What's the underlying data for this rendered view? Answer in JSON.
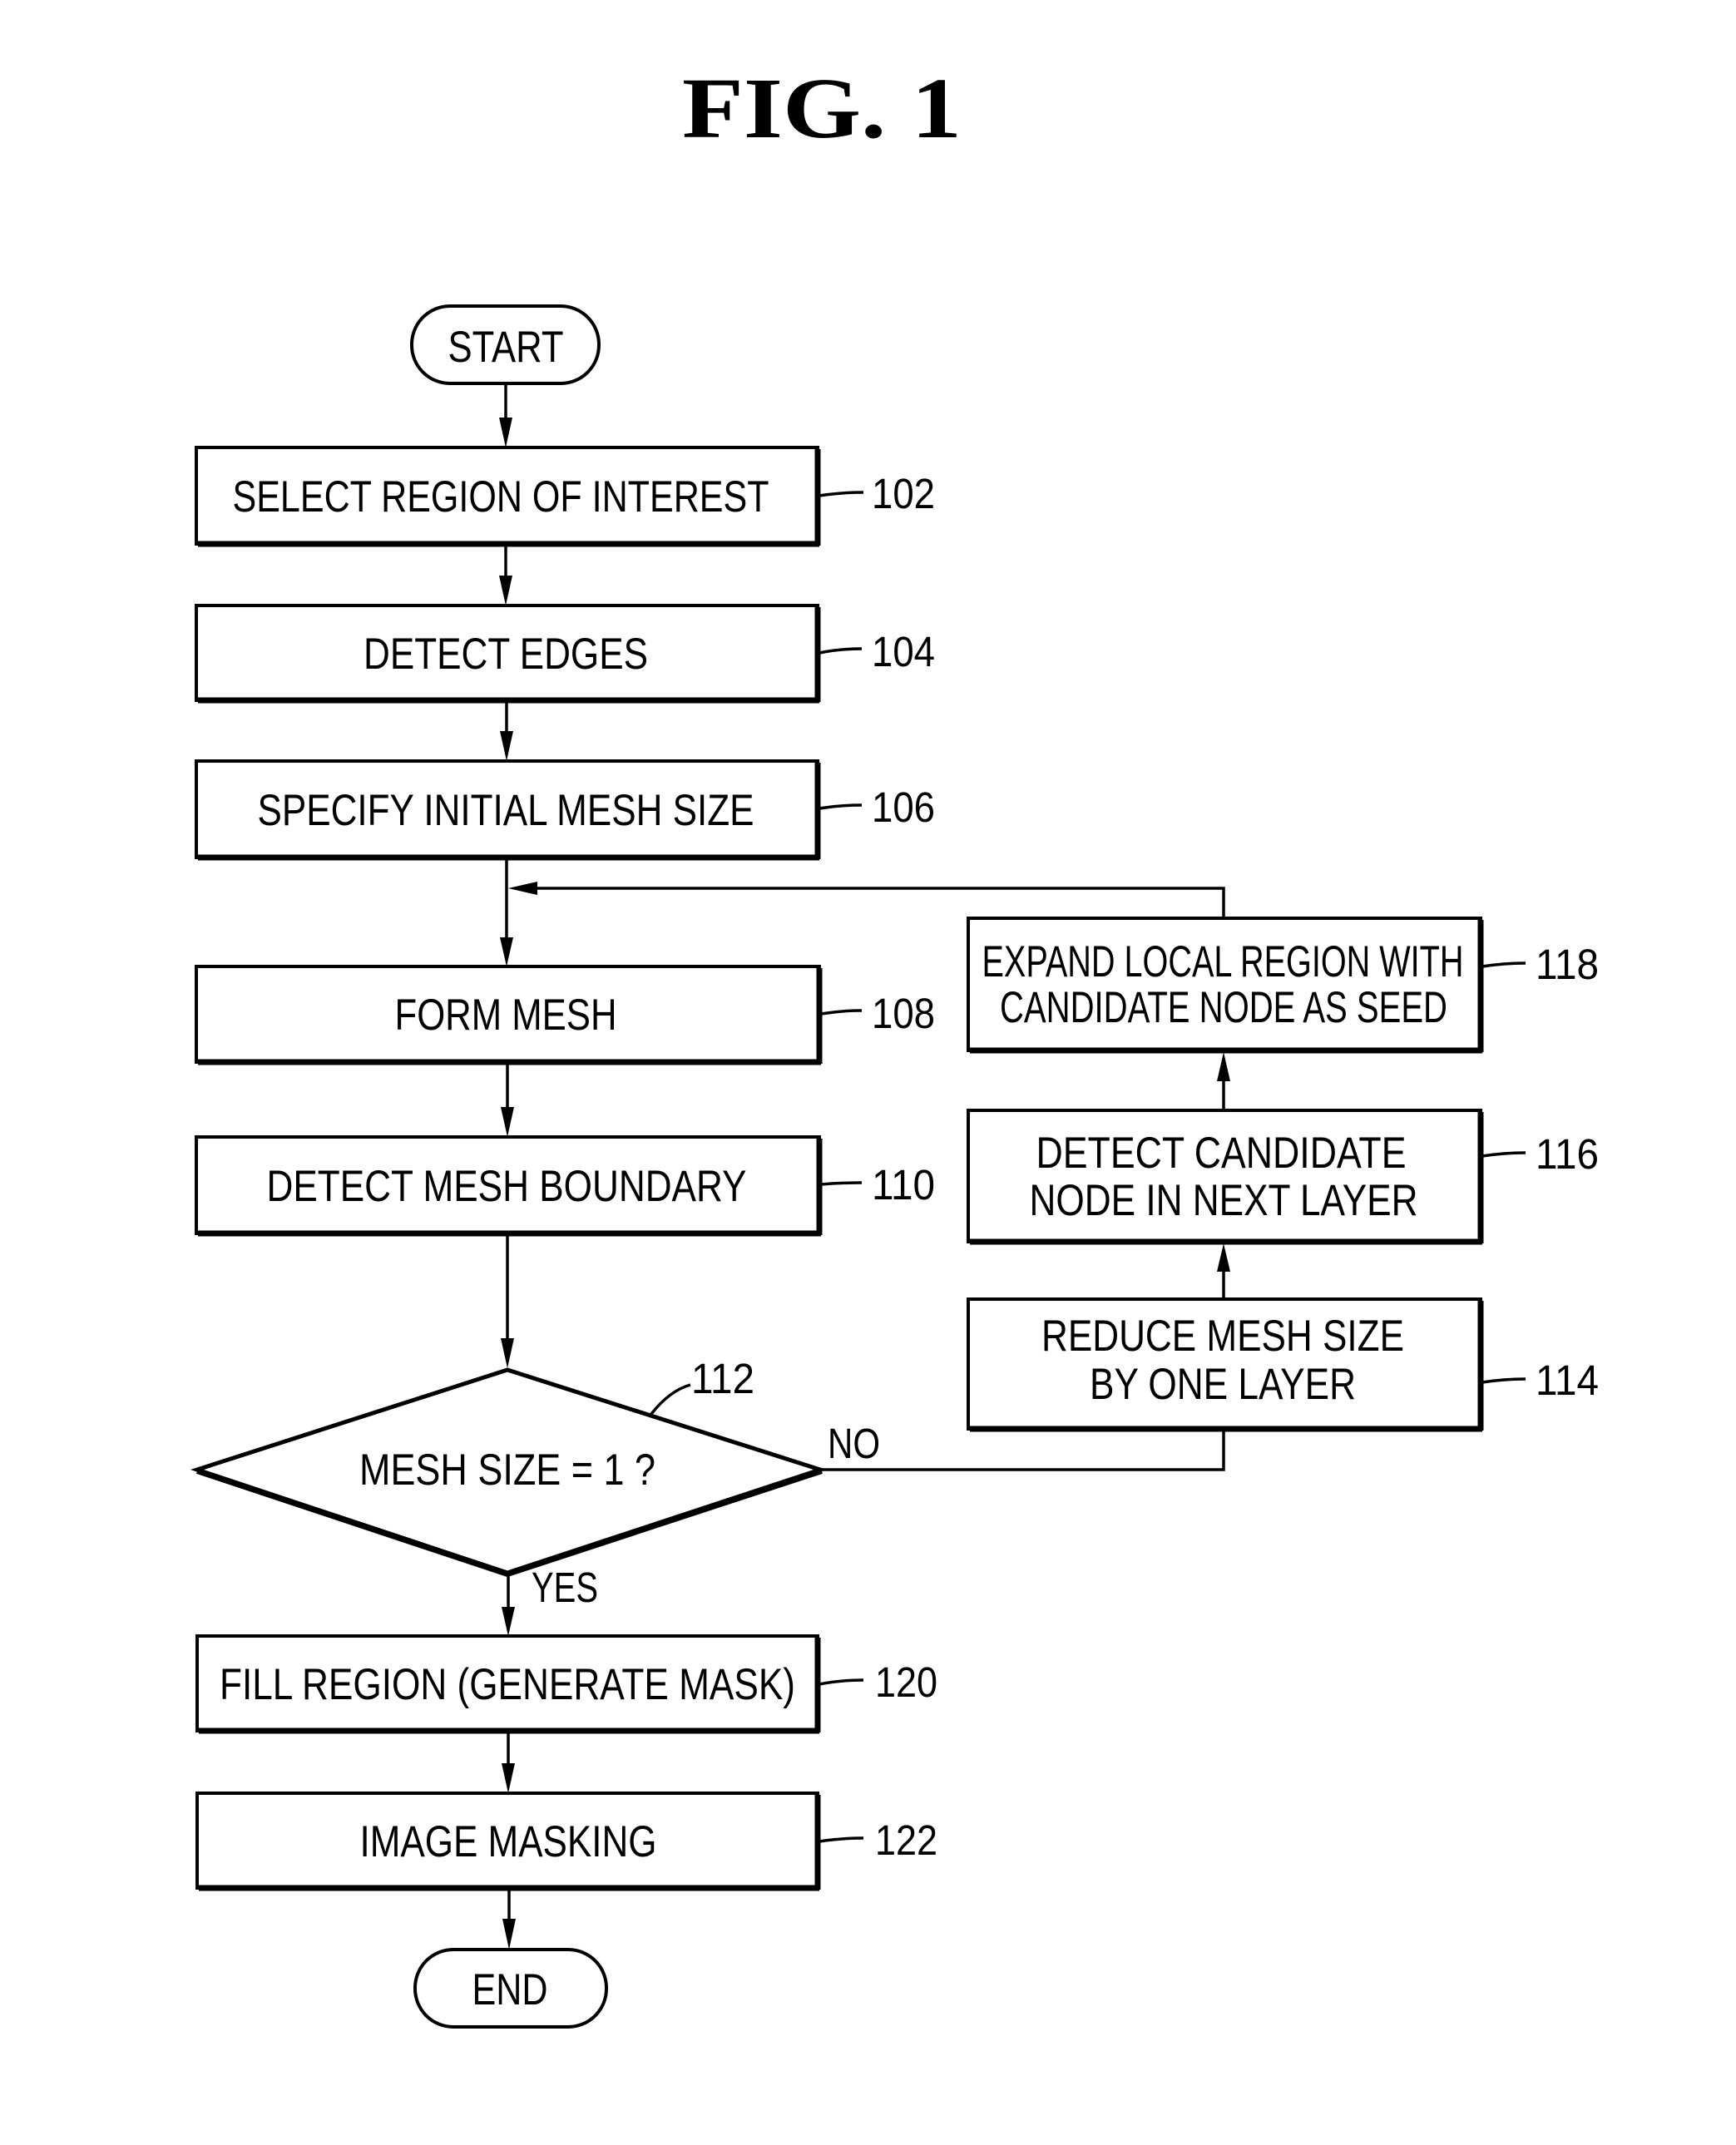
{
  "figure": {
    "title": "FIG.  1"
  },
  "flowchart": {
    "start": "START",
    "end": "END",
    "steps": {
      "s102": {
        "ref": "102",
        "label": "SELECT REGION OF INTEREST"
      },
      "s104": {
        "ref": "104",
        "label": "DETECT EDGES"
      },
      "s106": {
        "ref": "106",
        "label": "SPECIFY INITIAL MESH SIZE"
      },
      "s108": {
        "ref": "108",
        "label": "FORM MESH"
      },
      "s110": {
        "ref": "110",
        "label": "DETECT MESH BOUNDARY"
      },
      "s112": {
        "ref": "112",
        "label": "MESH SIZE = 1 ?",
        "yes": "YES",
        "no": "NO"
      },
      "s114": {
        "ref": "114",
        "line1": "REDUCE MESH SIZE",
        "line2": "BY ONE LAYER"
      },
      "s116": {
        "ref": "116",
        "line1": "DETECT CANDIDATE",
        "line2": "NODE IN NEXT LAYER"
      },
      "s118": {
        "ref": "118",
        "line1": "EXPAND LOCAL REGION WITH",
        "line2": "CANDIDATE NODE AS SEED"
      },
      "s120": {
        "ref": "120",
        "label": "FILL REGION (GENERATE MASK)"
      },
      "s122": {
        "ref": "122",
        "label": "IMAGE MASKING"
      }
    },
    "connections": [
      [
        "START",
        "102"
      ],
      [
        "102",
        "104"
      ],
      [
        "104",
        "106"
      ],
      [
        "106",
        "108"
      ],
      [
        "108",
        "110"
      ],
      [
        "110",
        "112"
      ],
      [
        "112",
        "120",
        "YES"
      ],
      [
        "112",
        "114",
        "NO"
      ],
      [
        "114",
        "116"
      ],
      [
        "116",
        "118"
      ],
      [
        "118",
        "108"
      ],
      [
        "120",
        "122"
      ],
      [
        "122",
        "END"
      ]
    ]
  }
}
